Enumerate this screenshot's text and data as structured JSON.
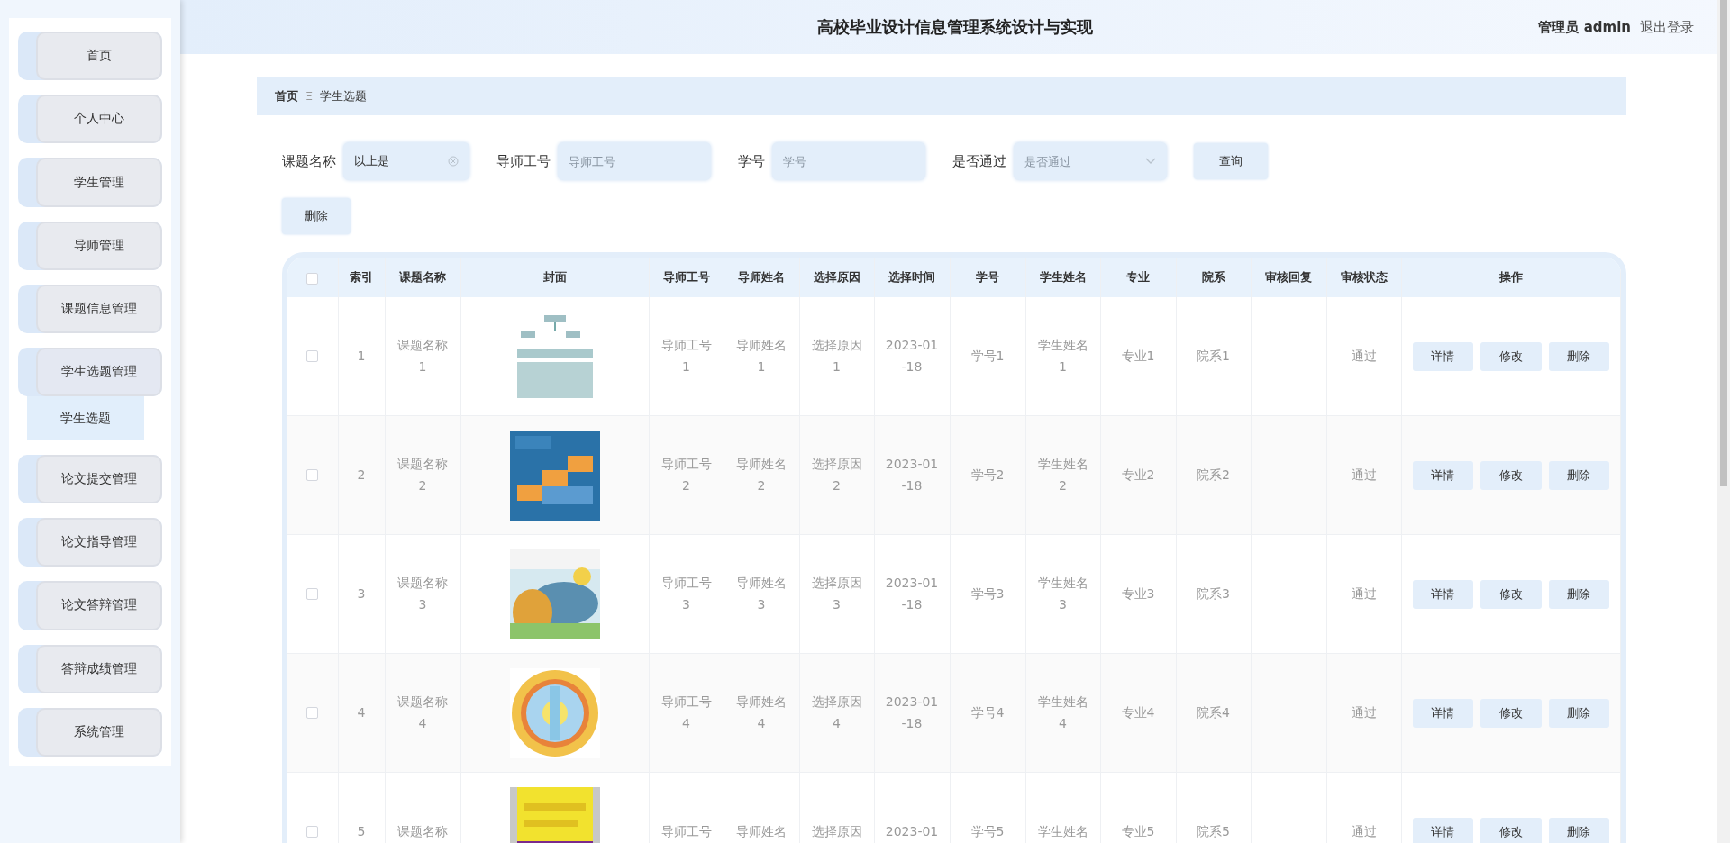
{
  "sidebar": {
    "items": [
      {
        "label": "首页",
        "expanded": false
      },
      {
        "label": "个人中心",
        "expanded": false
      },
      {
        "label": "学生管理",
        "expanded": false
      },
      {
        "label": "导师管理",
        "expanded": false
      },
      {
        "label": "课题信息管理",
        "expanded": false
      },
      {
        "label": "学生选题管理",
        "expanded": true,
        "children": [
          {
            "label": "学生选题",
            "selected": true
          }
        ]
      },
      {
        "label": "论文提交管理",
        "expanded": false
      },
      {
        "label": "论文指导管理",
        "expanded": false
      },
      {
        "label": "论文答辩管理",
        "expanded": false
      },
      {
        "label": "答辩成绩管理",
        "expanded": false
      },
      {
        "label": "系统管理",
        "expanded": false
      }
    ]
  },
  "header": {
    "title": "高校毕业设计信息管理系统设计与实现",
    "user": "管理员 admin",
    "logout": "退出登录"
  },
  "breadcrumb": {
    "items": [
      "首页",
      "学生选题"
    ],
    "separator": "Ξ"
  },
  "search": {
    "fields": [
      {
        "kind": "input",
        "label": "课题名称",
        "value": "以上是"
      },
      {
        "kind": "input",
        "label": "导师工号",
        "placeholder": "导师工号"
      },
      {
        "kind": "input",
        "label": "学号",
        "placeholder": "学号"
      },
      {
        "kind": "select",
        "label": "是否通过",
        "placeholder": "是否通过"
      }
    ],
    "query_button": "查询",
    "delete_button": "删除"
  },
  "table": {
    "select_all_checked": false,
    "columns": [
      "索引",
      "课题名称",
      "封面",
      "导师工号",
      "导师姓名",
      "选择原因",
      "选择时间",
      "学号",
      "学生姓名",
      "专业",
      "院系",
      "审核回复",
      "审核状态",
      "操作"
    ],
    "rows": [
      {
        "checked": false,
        "index": "1",
        "topic": "课题名称1",
        "teacher_id": "导师工号1",
        "teacher_name": "导师姓名1",
        "reason": "选择原因1",
        "time": "2023-01-18",
        "student_id": "学号1",
        "student_name": "学生姓名1",
        "major": "专业1",
        "department": "院系1",
        "status": "通过",
        "actions": [
          "详情",
          "修改",
          "删除"
        ]
      },
      {
        "checked": false,
        "index": "2",
        "topic": "课题名称2",
        "teacher_id": "导师工号2",
        "teacher_name": "导师姓名2",
        "reason": "选择原因2",
        "time": "2023-01-18",
        "student_id": "学号2",
        "student_name": "学生姓名2",
        "major": "专业2",
        "department": "院系2",
        "status": "通过",
        "actions": [
          "详情",
          "修改",
          "删除"
        ]
      },
      {
        "checked": false,
        "index": "3",
        "topic": "课题名称3",
        "teacher_id": "导师工号3",
        "teacher_name": "导师姓名3",
        "reason": "选择原因3",
        "time": "2023-01-18",
        "student_id": "学号3",
        "student_name": "学生姓名3",
        "major": "专业3",
        "department": "院系3",
        "status": "通过",
        "actions": [
          "详情",
          "修改",
          "删除"
        ]
      },
      {
        "checked": false,
        "index": "4",
        "topic": "课题名称4",
        "teacher_id": "导师工号4",
        "teacher_name": "导师姓名4",
        "reason": "选择原因4",
        "time": "2023-01-18",
        "student_id": "学号4",
        "student_name": "学生姓名4",
        "major": "专业4",
        "department": "院系4",
        "status": "通过",
        "actions": [
          "详情",
          "修改",
          "删除"
        ]
      },
      {
        "checked": false,
        "index": "5",
        "topic": "课题名称",
        "teacher_id": "导师工号",
        "teacher_name": "导师姓名",
        "reason": "选择原因",
        "time": "2023-01",
        "student_id": "学号5",
        "student_name": "学生姓名",
        "major": "专业5",
        "department": "院系5",
        "status": "通过",
        "actions": [
          "详情",
          "修改",
          "删除"
        ]
      }
    ]
  }
}
